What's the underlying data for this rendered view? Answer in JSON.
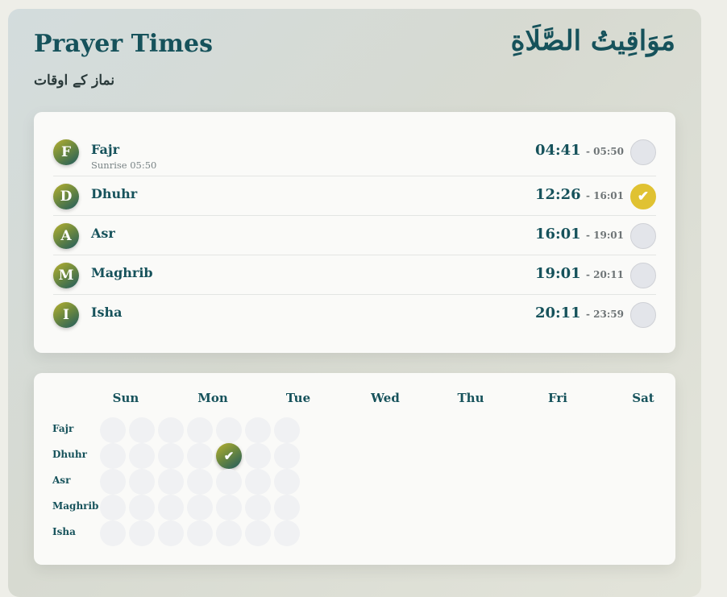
{
  "header": {
    "title_en": "Prayer Times",
    "title_ar": "مَوَاقِيتُ الصَّلَاةِ",
    "subtitle_ur": "نماز کے اوقات"
  },
  "prayers": [
    {
      "initial": "F",
      "name": "Fajr",
      "sub": "Sunrise 05:50",
      "start": "04:41",
      "end": "- 05:50",
      "done": false
    },
    {
      "initial": "D",
      "name": "Dhuhr",
      "sub": "",
      "start": "12:26",
      "end": "- 16:01",
      "done": true
    },
    {
      "initial": "A",
      "name": "Asr",
      "sub": "",
      "start": "16:01",
      "end": "- 19:01",
      "done": false
    },
    {
      "initial": "M",
      "name": "Maghrib",
      "sub": "",
      "start": "19:01",
      "end": "- 20:11",
      "done": false
    },
    {
      "initial": "I",
      "name": "Isha",
      "sub": "",
      "start": "20:11",
      "end": "- 23:59",
      "done": false
    }
  ],
  "check_glyph": "✔",
  "tracker": {
    "days": [
      "Sun",
      "Mon",
      "Tue",
      "Wed",
      "Thu",
      "Fri",
      "Sat"
    ],
    "rows": [
      "Fajr",
      "Dhuhr",
      "Asr",
      "Maghrib",
      "Isha"
    ],
    "done": [
      [
        false,
        false,
        false,
        false,
        false,
        false,
        false
      ],
      [
        false,
        false,
        false,
        false,
        true,
        false,
        false
      ],
      [
        false,
        false,
        false,
        false,
        false,
        false,
        false
      ],
      [
        false,
        false,
        false,
        false,
        false,
        false,
        false
      ],
      [
        false,
        false,
        false,
        false,
        false,
        false,
        false
      ]
    ]
  },
  "colors": {
    "accent": "#16525b",
    "check_done": "#e0c232"
  }
}
